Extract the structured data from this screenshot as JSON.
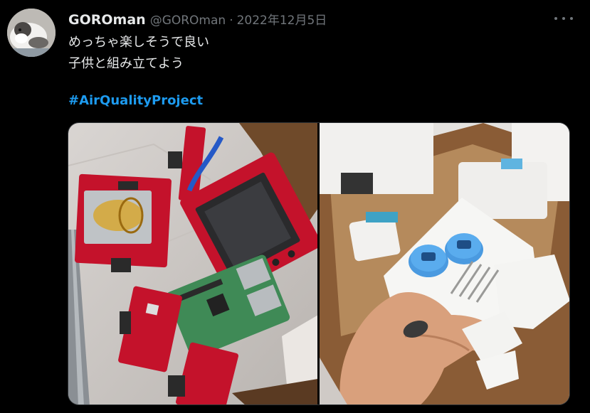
{
  "tweet": {
    "display_name": "GOROman",
    "handle": "@GOROman",
    "separator": "·",
    "date": "2022年12月5日",
    "text_line_1": "めっちゃ楽しそうで良い",
    "text_line_2": "子供と組み立てよう",
    "hashtag": "#AirQualityProject"
  },
  "icons": {
    "more": "more-horizontal-icon"
  },
  "colors": {
    "background": "#000000",
    "primary_text": "#e7e9ea",
    "secondary_text": "#71767b",
    "hashtag": "#1d9bf0",
    "board_red": "#c8102e"
  }
}
